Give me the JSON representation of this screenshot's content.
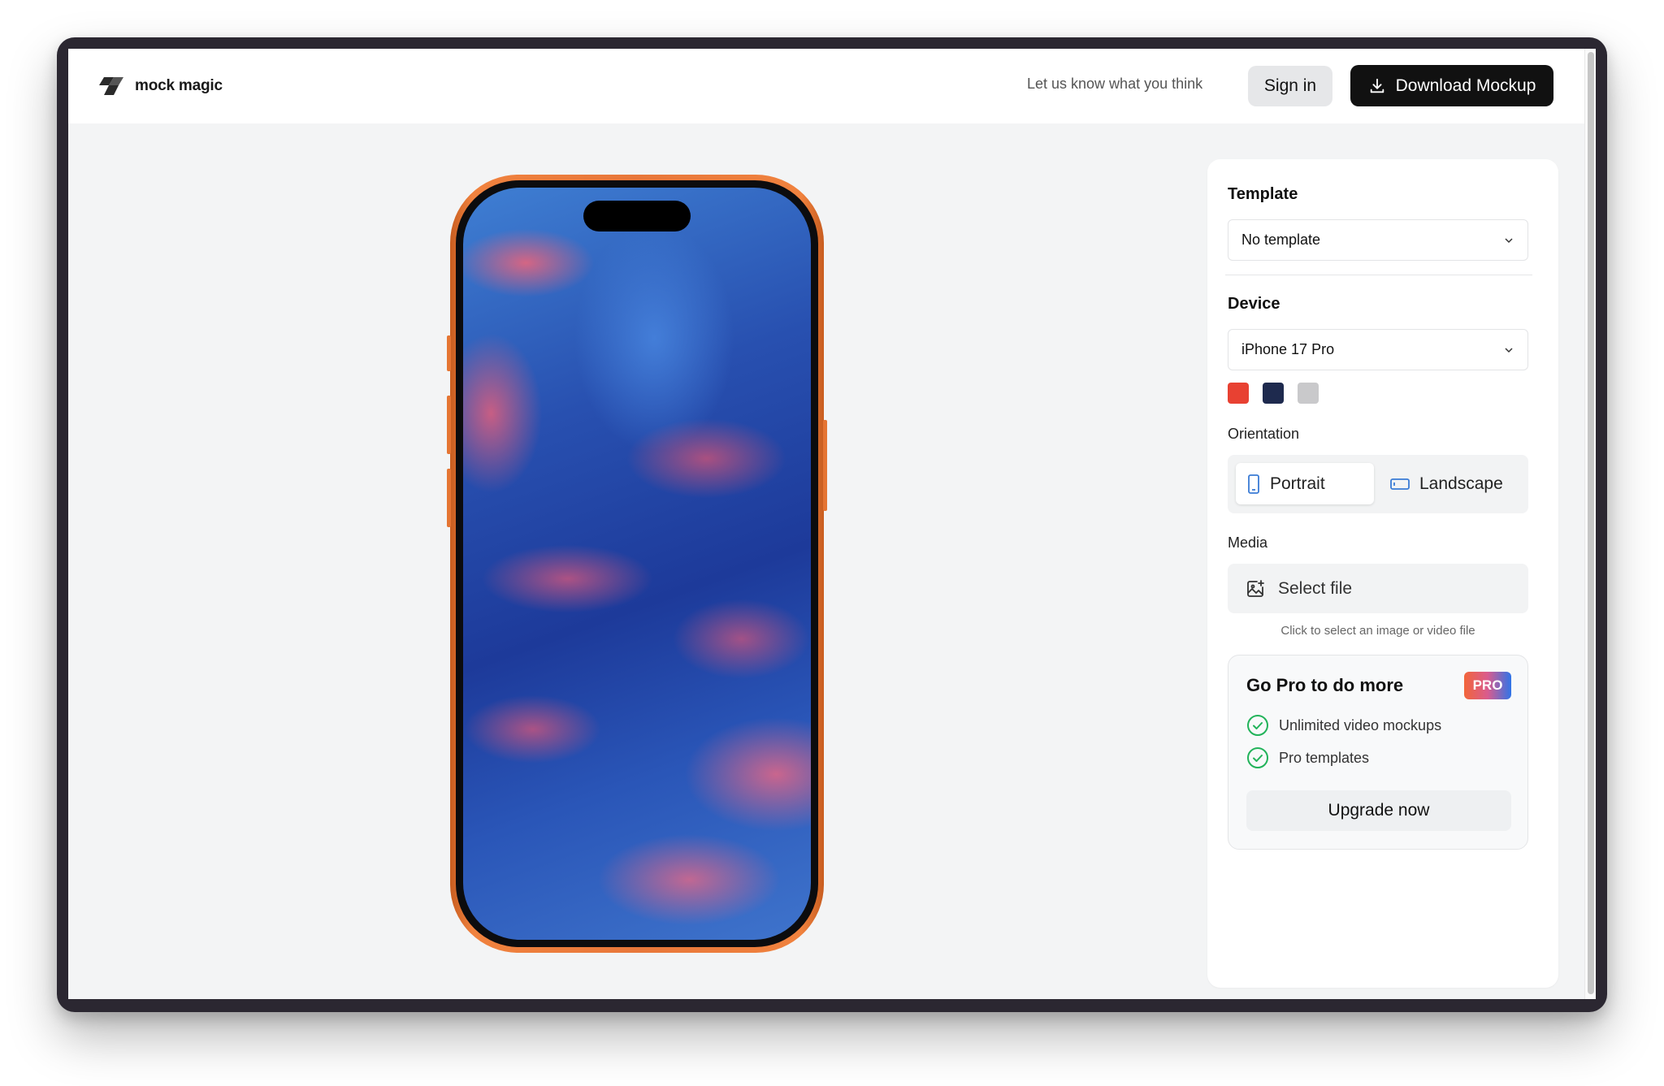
{
  "app": {
    "name": "mock magic"
  },
  "header": {
    "feedback_link": "Let us know what you think",
    "signin_label": "Sign in",
    "download_label": "Download Mockup"
  },
  "panel": {
    "template": {
      "title": "Template",
      "selected": "No template"
    },
    "device": {
      "title": "Device",
      "selected": "iPhone 17 Pro",
      "colors": [
        "#e84132",
        "#1e2a4e",
        "#c9c9cb"
      ]
    },
    "orientation": {
      "label": "Orientation",
      "options": [
        "Portrait",
        "Landscape"
      ],
      "selected": "Portrait"
    },
    "media": {
      "label": "Media",
      "button_label": "Select file",
      "hint": "Click to select an image or video file"
    },
    "pro": {
      "title": "Go Pro to do more",
      "badge": "PRO",
      "features": [
        "Unlimited video mockups",
        "Pro templates"
      ],
      "cta": "Upgrade now"
    }
  },
  "icons": {
    "logo": "mock-magic-logo-icon",
    "download": "download-icon",
    "chevron": "chevron-down-icon",
    "portrait": "phone-portrait-icon",
    "landscape": "phone-landscape-icon",
    "image_add": "image-add-icon",
    "check": "check-circle-icon"
  }
}
